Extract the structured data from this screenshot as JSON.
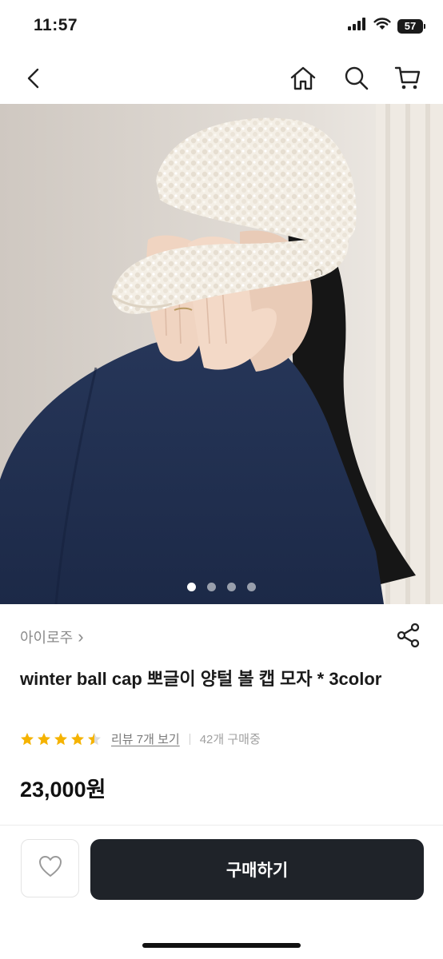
{
  "status_bar": {
    "time": "11:57",
    "battery": "57",
    "icons": [
      "signal-icon",
      "wifi-icon",
      "battery-icon"
    ]
  },
  "nav": {
    "icons": [
      "back-arrow-icon",
      "home-icon",
      "search-icon",
      "cart-icon"
    ]
  },
  "gallery": {
    "image_count": 4,
    "active_index": 0
  },
  "product": {
    "brand": "아이로주",
    "brand_chevron": "›",
    "title": "winter ball cap 뽀글이 양털 볼 캡 모자 * 3color",
    "rating": 4.5,
    "review_link": "리뷰 7개 보기",
    "buy_count": "42개 구매중",
    "price": "23,000원"
  },
  "bottom_bar": {
    "buy_label": "구매하기",
    "wish_icon": "heart-icon"
  },
  "colors": {
    "accent_star": "#f5b301",
    "buy_button": "#1f2329",
    "text": "#1a1a1a"
  }
}
